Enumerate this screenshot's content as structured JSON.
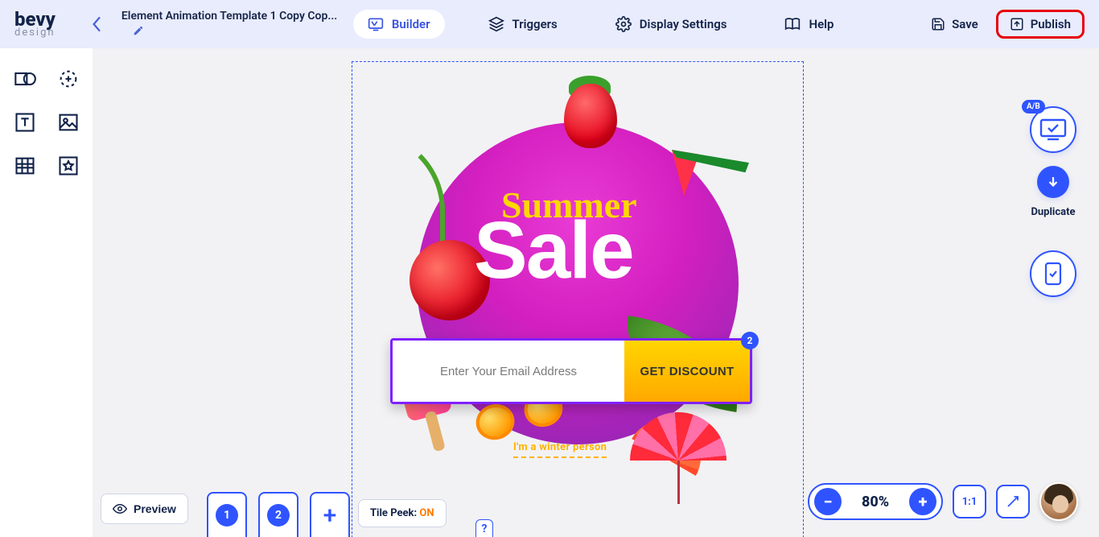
{
  "logo": {
    "main": "bevy",
    "sub": "design"
  },
  "project": {
    "title": "Element Animation Template 1 Copy Cop..."
  },
  "nav": {
    "builder": "Builder",
    "triggers": "Triggers",
    "display_settings": "Display Settings",
    "help": "Help"
  },
  "actions": {
    "save": "Save",
    "publish": "Publish"
  },
  "popup": {
    "headline1": "Summer",
    "headline2": "Sale",
    "email_placeholder": "Enter Your Email Address",
    "cta": "GET DISCOUNT",
    "badge": "2",
    "winter_link": "I'm a winter person"
  },
  "right_tools": {
    "ab": "A/B",
    "duplicate_label": "Duplicate"
  },
  "bottom": {
    "preview": "Preview",
    "tile1": "1",
    "tile2": "2",
    "tilepeek_label": "Tile Peek: ",
    "tilepeek_state": "ON",
    "help_q": "?",
    "zoom": "80%",
    "one_to_one": "1:1"
  }
}
